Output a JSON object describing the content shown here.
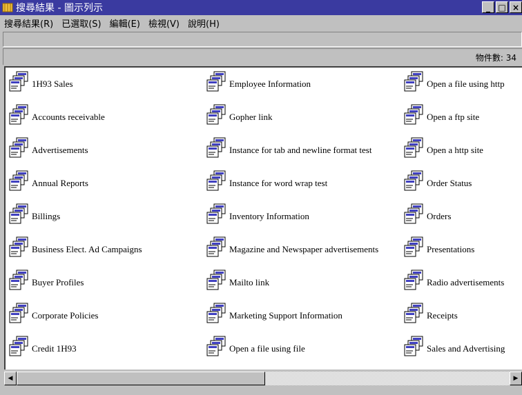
{
  "window": {
    "title": "搜尋結果 - 圖示列示",
    "minimize": "_",
    "maximize": "□",
    "close": "×"
  },
  "menu": [
    "搜尋結果(R)",
    "已選取(S)",
    "編輯(E)",
    "檢視(V)",
    "說明(H)"
  ],
  "status": {
    "count": "物件數: 34"
  },
  "columns": [
    [
      "1H93 Sales",
      "Accounts receivable",
      "Advertisements",
      "Annual Reports",
      "Billings",
      "Business Elect. Ad Campaigns",
      "Buyer Profiles",
      "Corporate Policies",
      "Credit 1H93"
    ],
    [
      "Employee Information",
      "Gopher link",
      "Instance for tab and newline format test",
      "Instance for word wrap test",
      "Inventory Information",
      "Magazine and Newspaper advertisements",
      "Mailto link",
      "Marketing Support Information",
      "Open a file using file"
    ],
    [
      "Open a file using http",
      "Open a ftp site",
      "Open a http site",
      "Order Status",
      "Orders",
      "Presentations",
      "Radio advertisements",
      "Receipts",
      "Sales and Advertising"
    ]
  ],
  "scrollbar": {
    "left_arrow": "◀",
    "right_arrow": "▶"
  }
}
